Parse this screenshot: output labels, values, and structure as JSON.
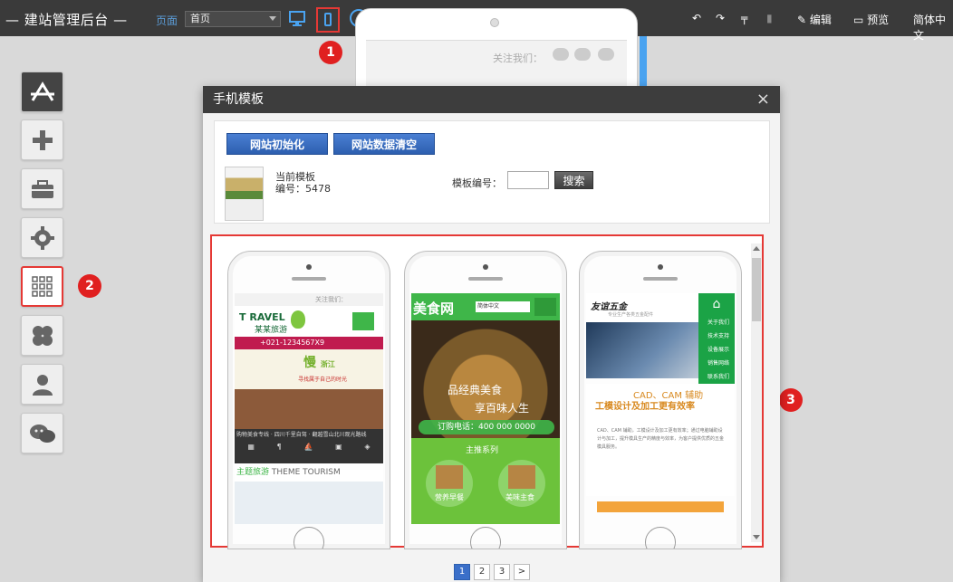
{
  "topbar": {
    "brand": "建站管理后台",
    "page_label": "页面",
    "page_select_value": "首页",
    "edit_label": "编辑",
    "preview_label": "预览",
    "language_label": "简体中文"
  },
  "phone_preview": {
    "follow_label": "关注我们："
  },
  "sidebar": {
    "items": [
      {
        "icon": "app-store-icon"
      },
      {
        "icon": "plus-icon"
      },
      {
        "icon": "toolbox-icon"
      },
      {
        "icon": "gear-icon"
      },
      {
        "icon": "grid-icon",
        "active": true
      },
      {
        "icon": "clover-icon"
      },
      {
        "icon": "user-icon"
      },
      {
        "icon": "wechat-icon"
      }
    ]
  },
  "callouts": [
    "1",
    "2",
    "3"
  ],
  "modal": {
    "title": "手机模板",
    "close": "×",
    "init_button": "网站初始化",
    "clear_button": "网站数据清空",
    "current_label": "当前模板",
    "current_number": "编号：5478",
    "template_no_label": "模板编号：",
    "search_button": "搜索",
    "template_no_value": ""
  },
  "templates": [
    {
      "name": "travel",
      "follow": "关注我们：",
      "logo": "RAVEL",
      "logo_initial": "T",
      "logo_sub": "某某旅游",
      "phone": "+021-1234567X9",
      "slow_char": "慢",
      "zhe": "浙",
      "jiang": "江",
      "banner_text": "寻找属于自己的时光",
      "nav_text": "购物美食专线 · 四川千里自驾 · 翻越雪山北川观光路线",
      "theme_cn": "主题旅游",
      "theme_en": "THEME TOURISM"
    },
    {
      "name": "food",
      "logo": "美食网",
      "lang": "简体中文",
      "slogan1": "品经典美食",
      "slogan2": "享百味人生",
      "call": "订购电话：400 000 0000",
      "series": "主推系列",
      "item1": "营养早餐",
      "item2": "美味主食"
    },
    {
      "name": "hardware",
      "logo": "友谊五金",
      "logo_sub": "专业生产各类五金配件",
      "nav": [
        "关于我们",
        "技术支持",
        "设备展示",
        "销售网络",
        "联系我们"
      ],
      "cad1": "CAD、CAM 辅助",
      "cad2": "工模设计及加工更有效率",
      "body": "CAD、CAM 辅助，工模设计及加工更有效率；通过电脑辅助设计与加工，提升模具生产的精度与效率，为客户提供优质的五金模具服务。"
    }
  ],
  "pagination": {
    "pages": [
      "1",
      "2",
      "3"
    ],
    "next": ">",
    "active": "1"
  }
}
